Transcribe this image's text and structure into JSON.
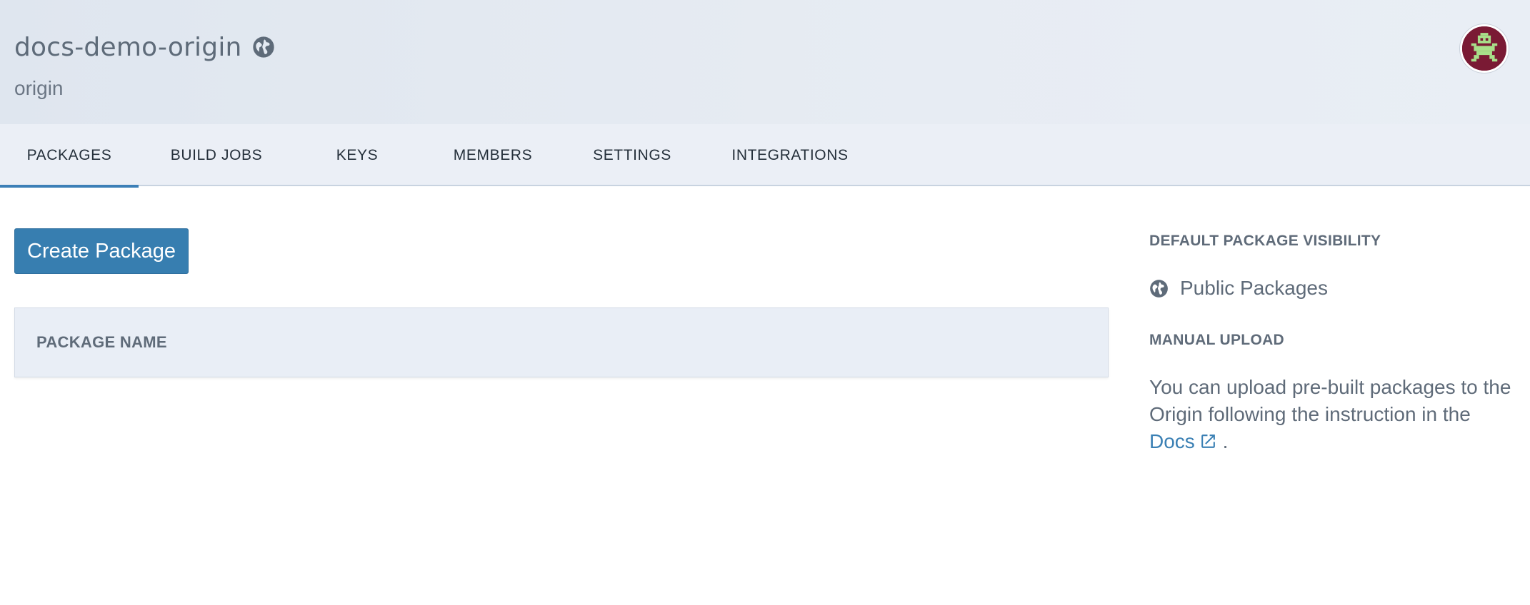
{
  "origin": {
    "name": "docs-demo-origin",
    "subtitle": "origin"
  },
  "tabs": [
    {
      "label": "PACKAGES",
      "active": true
    },
    {
      "label": "BUILD JOBS",
      "active": false
    },
    {
      "label": "KEYS",
      "active": false
    },
    {
      "label": "MEMBERS",
      "active": false
    },
    {
      "label": "SETTINGS",
      "active": false
    },
    {
      "label": "INTEGRATIONS",
      "active": false
    }
  ],
  "main": {
    "create_button": "Create Package",
    "table_header": "PACKAGE NAME"
  },
  "sidebar": {
    "visibility_heading": "DEFAULT PACKAGE VISIBILITY",
    "visibility_value": "Public Packages",
    "upload_heading": "MANUAL UPLOAD",
    "upload_text": "You can upload pre-built packages to the Origin following the instruction in the",
    "docs_link": "Docs",
    "trailing": "."
  },
  "colors": {
    "accent": "#3c7fb7",
    "button": "#377eb0",
    "avatar_bg": "#7a1a34",
    "avatar_fg": "#a8e08a"
  },
  "icons": {
    "title_icon": "globe-icon",
    "visibility_icon": "globe-icon",
    "link_icon": "external-link-icon",
    "avatar": "space-invader-avatar"
  }
}
